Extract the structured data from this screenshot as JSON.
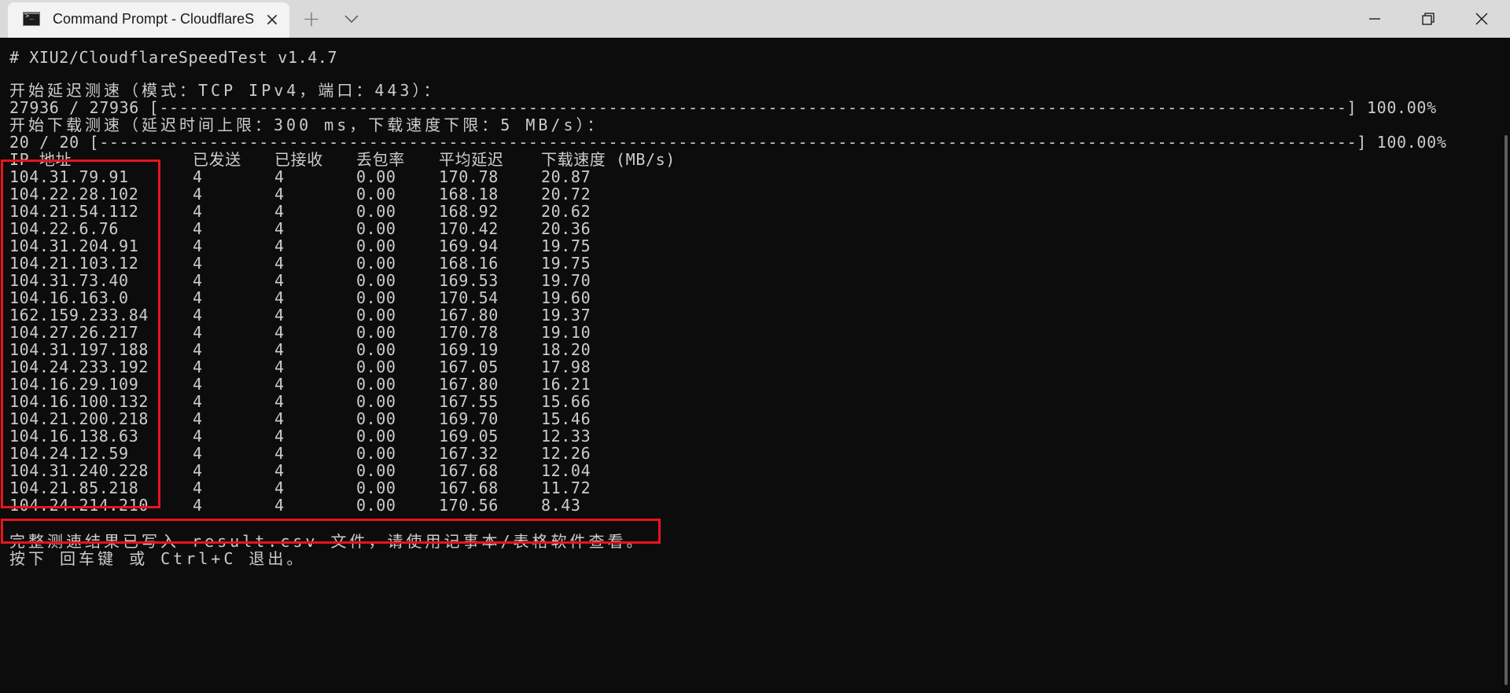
{
  "window": {
    "tab_title": "Command Prompt - CloudflareS",
    "tab_close_icon": "×",
    "new_tab_icon": "+"
  },
  "terminal": {
    "header": "# XIU2/CloudflareSpeedTest v1.4.7",
    "latency_start": "开始延迟测速（模式：TCP IPv4，端口：443）：",
    "latency_progress": "27936 / 27936 [-----------------------------------------------------------------------------------------------------------------------] 100.00%",
    "download_start": "开始下载测速（延迟时间上限：300 ms，下载速度下限：5 MB/s）：",
    "download_progress": "20 / 20 [------------------------------------------------------------------------------------------------------------------------------] 100.00%",
    "table": {
      "headers": [
        "IP 地址",
        "已发送",
        "已接收",
        "丢包率",
        "平均延迟",
        "下载速度 (MB/s)"
      ],
      "rows": [
        [
          "104.31.79.91",
          "4",
          "4",
          "0.00",
          "170.78",
          "20.87"
        ],
        [
          "104.22.28.102",
          "4",
          "4",
          "0.00",
          "168.18",
          "20.72"
        ],
        [
          "104.21.54.112",
          "4",
          "4",
          "0.00",
          "168.92",
          "20.62"
        ],
        [
          "104.22.6.76",
          "4",
          "4",
          "0.00",
          "170.42",
          "20.36"
        ],
        [
          "104.31.204.91",
          "4",
          "4",
          "0.00",
          "169.94",
          "19.75"
        ],
        [
          "104.21.103.12",
          "4",
          "4",
          "0.00",
          "168.16",
          "19.75"
        ],
        [
          "104.31.73.40",
          "4",
          "4",
          "0.00",
          "169.53",
          "19.70"
        ],
        [
          "104.16.163.0",
          "4",
          "4",
          "0.00",
          "170.54",
          "19.60"
        ],
        [
          "162.159.233.84",
          "4",
          "4",
          "0.00",
          "167.80",
          "19.37"
        ],
        [
          "104.27.26.217",
          "4",
          "4",
          "0.00",
          "170.78",
          "19.10"
        ],
        [
          "104.31.197.188",
          "4",
          "4",
          "0.00",
          "169.19",
          "18.20"
        ],
        [
          "104.24.233.192",
          "4",
          "4",
          "0.00",
          "167.05",
          "17.98"
        ],
        [
          "104.16.29.109",
          "4",
          "4",
          "0.00",
          "167.80",
          "16.21"
        ],
        [
          "104.16.100.132",
          "4",
          "4",
          "0.00",
          "167.55",
          "15.66"
        ],
        [
          "104.21.200.218",
          "4",
          "4",
          "0.00",
          "169.70",
          "15.46"
        ],
        [
          "104.16.138.63",
          "4",
          "4",
          "0.00",
          "169.05",
          "12.33"
        ],
        [
          "104.24.12.59",
          "4",
          "4",
          "0.00",
          "167.32",
          "12.26"
        ],
        [
          "104.31.240.228",
          "4",
          "4",
          "0.00",
          "167.68",
          "12.04"
        ],
        [
          "104.21.85.218",
          "4",
          "4",
          "0.00",
          "167.68",
          "11.72"
        ],
        [
          "104.24.214.210",
          "4",
          "4",
          "0.00",
          "170.56",
          "8.43"
        ]
      ]
    },
    "result_message": "完整测速结果已写入 result.csv 文件，请使用记事本/表格软件查看。",
    "exit_prompt": "按下 回车键 或 Ctrl+C 退出。"
  },
  "colors": {
    "terminal_bg": "#0c0c0c",
    "terminal_fg": "#cccccc",
    "highlight_box": "#e8141c",
    "titlebar_bg": "#dadada",
    "active_tab_bg": "#f3f3f3"
  }
}
